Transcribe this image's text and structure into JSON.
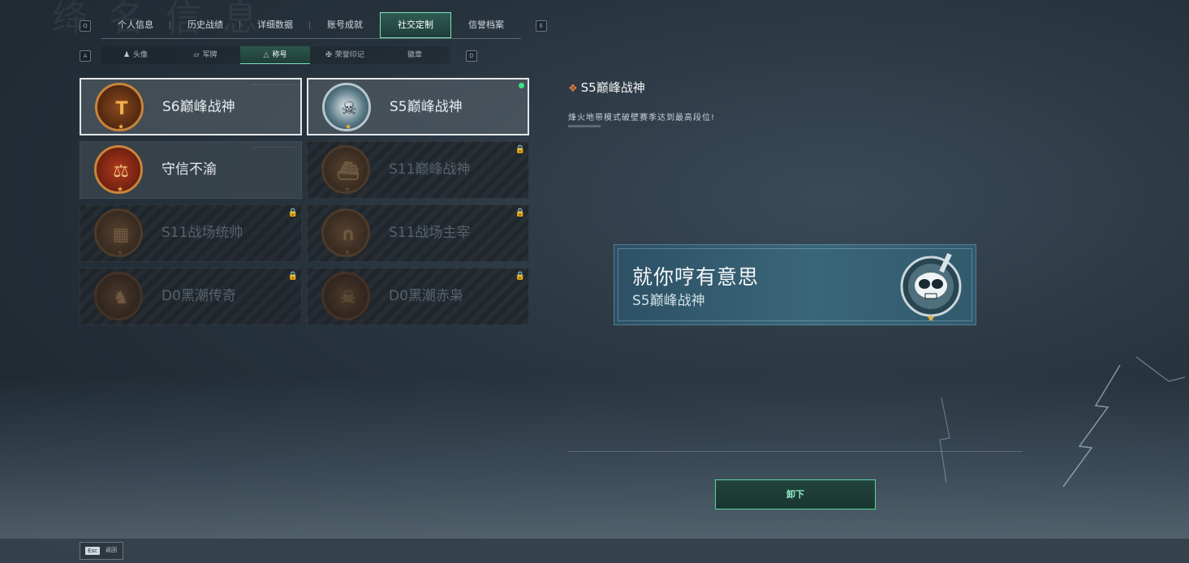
{
  "main_tabs": {
    "left_key": "Q",
    "right_key": "E",
    "items": [
      "个人信息",
      "历史战绩",
      "详细数据",
      "账号成就",
      "社交定制",
      "信誉档案"
    ],
    "active_index": 4
  },
  "sub_tabs": {
    "left_key": "A",
    "right_key": "D",
    "items": [
      {
        "label": "头像",
        "icon": "person-icon"
      },
      {
        "label": "军牌",
        "icon": "dogtag-icon"
      },
      {
        "label": "称号",
        "icon": "title-icon"
      },
      {
        "label": "荣誉印记",
        "icon": "honor-mark-icon"
      },
      {
        "label": "徽章",
        "icon": "badge-icon"
      }
    ],
    "active_index": 2
  },
  "cards": [
    {
      "name": "S6巅峰战神",
      "locked": false,
      "selected": true,
      "equipped": false,
      "medal": "shield-t-medal-icon"
    },
    {
      "name": "S5巅峰战神",
      "locked": false,
      "selected": true,
      "equipped": true,
      "medal": "diver-skull-medal-icon"
    },
    {
      "name": "守信不渝",
      "locked": false,
      "selected": false,
      "equipped": false,
      "medal": "scales-medal-icon"
    },
    {
      "name": "S11巅峰战神",
      "locked": true,
      "selected": false,
      "equipped": false,
      "medal": "boat-medal-icon"
    },
    {
      "name": "S11战场统帅",
      "locked": true,
      "selected": false,
      "equipped": false,
      "medal": "tank-medal-icon"
    },
    {
      "name": "S11战场主宰",
      "locked": true,
      "selected": false,
      "equipped": false,
      "medal": "arch-medal-icon"
    },
    {
      "name": "D0黑潮传奇",
      "locked": true,
      "selected": false,
      "equipped": false,
      "medal": "hooded-medal-icon"
    },
    {
      "name": "D0黑潮赤枭",
      "locked": true,
      "selected": false,
      "equipped": false,
      "medal": "owl-skull-medal-icon"
    }
  ],
  "detail": {
    "title": "S5巅峰战神",
    "description": "烽火地带模式破壁赛季达到最高段位!"
  },
  "preview": {
    "main_text": "就你哼有意思",
    "sub_text": "S5巅峰战神"
  },
  "actions": {
    "unequip_label": "卸下"
  },
  "footer": {
    "esc_key": "Esc",
    "back_label": "返回"
  },
  "colors": {
    "accent_green": "#5bd6a4",
    "equipped_dot": "#39e38a",
    "title_diamond": "#e07b3a",
    "medal_gold": "#c8843a"
  }
}
